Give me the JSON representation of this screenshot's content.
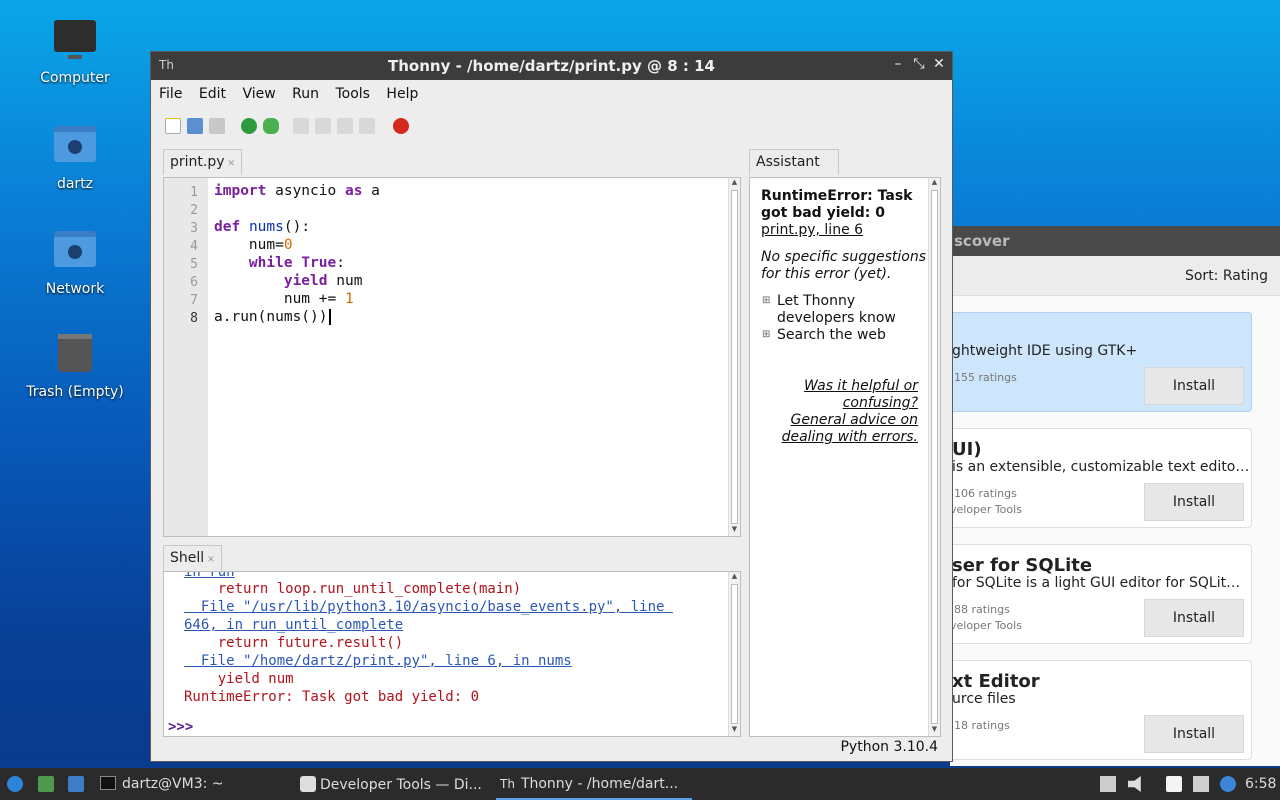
{
  "desktop": {
    "icons": [
      {
        "label": "Computer"
      },
      {
        "label": "dartz"
      },
      {
        "label": "Network"
      },
      {
        "label": "Trash (Empty)"
      }
    ]
  },
  "discover": {
    "title": "scover",
    "sort_label": "Sort: Rating",
    "cards": [
      {
        "title": "",
        "desc": "ghtweight IDE using GTK+",
        "ratings": "155 ratings",
        "category": "",
        "button": "Install"
      },
      {
        "title": "UI)",
        "desc": "is an extensible, customizable text edito…",
        "ratings": "106 ratings",
        "category": "veloper Tools",
        "button": "Install"
      },
      {
        "title": "ser for SQLite",
        "desc": "for SQLite is a light GUI editor for SQLit…",
        "ratings": "88 ratings",
        "category": "veloper Tools",
        "button": "Install"
      },
      {
        "title": "xt Editor",
        "desc": "urce files",
        "ratings": "18 ratings",
        "category": "",
        "button": "Install"
      }
    ]
  },
  "thonny": {
    "title": "Thonny  -  /home/dartz/print.py  @  8 : 14",
    "logo": "Th",
    "menu": [
      "File",
      "Edit",
      "View",
      "Run",
      "Tools",
      "Help"
    ],
    "editor_tab": "print.py",
    "line_numbers": [
      "1",
      "2",
      "3",
      "4",
      "5",
      "6",
      "7",
      "8"
    ],
    "code": {
      "l1_kw1": "import",
      "l1_rest": " asyncio ",
      "l1_kw2": "as",
      "l1_end": " a",
      "l3_kw": "def",
      "l3_fn": "nums",
      "l3_rest": "():",
      "l4": "    num=",
      "l4_num": "0",
      "l5_indent": "    ",
      "l5_kw": "while",
      "l5_kw2": "True",
      "l5_end": ":",
      "l6_indent": "        ",
      "l6_kw": "yield",
      "l6_rest": " num",
      "l7": "        num += ",
      "l7_num": "1",
      "l8": "a.run(nums())"
    },
    "shell_tab": "Shell",
    "shell_lines": {
      "partial": "in run",
      "s1": "    return loop.run_until_complete(main)",
      "s2": "  File \"/usr/lib/python3.10/asyncio/base_events.py\", line ",
      "s3": "646, in run_until_complete",
      "s4": "    return future.result()",
      "s5": "  File \"/home/dartz/print.py\", line 6, in nums",
      "s6": "    yield num",
      "s7": "RuntimeError: Task got bad yield: 0",
      "prompt": ">>>"
    },
    "assistant_tab": "Assistant",
    "assistant": {
      "heading1": "RuntimeError: Task",
      "heading2": "got bad yield: 0",
      "location": "print.py, line 6",
      "note1": "No specific suggestions",
      "note2": "for this error (yet).",
      "opt1a": "Let Thonny",
      "opt1b": "developers know",
      "opt2": "Search the web",
      "help1": "Was it helpful or",
      "help2": "confusing?",
      "help3": "General advice on",
      "help4": "dealing with errors."
    },
    "status": "Python 3.10.4"
  },
  "taskbar": {
    "tasks": [
      {
        "label": "dartz@VM3: ~"
      },
      {
        "label": "Developer Tools — Di..."
      },
      {
        "label": "Thonny  -  /home/dart..."
      }
    ],
    "clock": "6:58"
  }
}
